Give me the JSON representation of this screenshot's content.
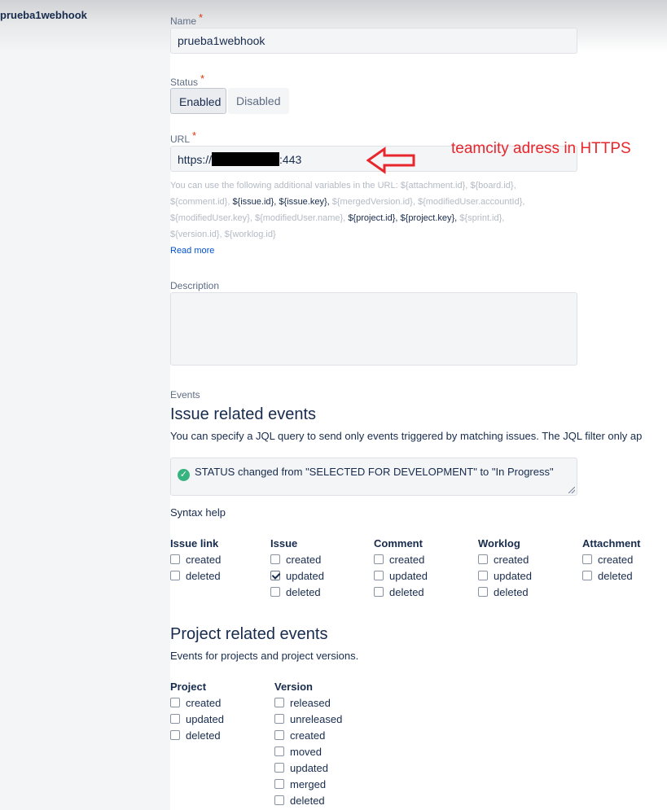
{
  "sidebar": {
    "title": "prueba1webhook"
  },
  "form": {
    "name_label": "Name",
    "required_mark": "*",
    "name_value": "prueba1webhook",
    "status_label": "Status",
    "status_options": [
      "Enabled",
      "Disabled"
    ],
    "status_selected": "Enabled",
    "url_label": "URL",
    "url_prefix": "https://",
    "url_suffix": ":443",
    "help": {
      "intro": "You can use the following additional variables in the URL:",
      "vars": [
        {
          "text": "${attachment.id},",
          "dark": false
        },
        {
          "text": "${board.id},",
          "dark": false
        },
        {
          "text": "${comment.id},",
          "dark": false
        },
        {
          "text": "${issue.id},",
          "dark": true
        },
        {
          "text": "${issue.key},",
          "dark": true
        },
        {
          "text": "${mergedVersion.id},",
          "dark": false
        },
        {
          "text": "${modifiedUser.accountId},",
          "dark": false
        },
        {
          "text": "${modifiedUser.key},",
          "dark": false
        },
        {
          "text": "${modifiedUser.name},",
          "dark": false
        },
        {
          "text": "${project.id},",
          "dark": true
        },
        {
          "text": "${project.key},",
          "dark": true
        },
        {
          "text": "${sprint.id},",
          "dark": false
        },
        {
          "text": "${version.id},",
          "dark": false
        },
        {
          "text": "${worklog.id}",
          "dark": false
        }
      ],
      "read_more": "Read more"
    },
    "description_label": "Description",
    "description_value": ""
  },
  "events": {
    "label": "Events",
    "issue_heading": "Issue related events",
    "issue_desc": "You can specify a JQL query to send only events triggered by matching issues. The JQL filter only ap",
    "jql_value": "STATUS changed from \"SELECTED FOR DEVELOPMENT\" to \"In Progress\"",
    "syntax_help": "Syntax help",
    "issue_groups": [
      {
        "title": "Issue link",
        "items": [
          {
            "label": "created",
            "checked": false
          },
          {
            "label": "deleted",
            "checked": false
          }
        ]
      },
      {
        "title": "Issue",
        "items": [
          {
            "label": "created",
            "checked": false
          },
          {
            "label": "updated",
            "checked": true
          },
          {
            "label": "deleted",
            "checked": false
          }
        ]
      },
      {
        "title": "Comment",
        "items": [
          {
            "label": "created",
            "checked": false
          },
          {
            "label": "updated",
            "checked": false
          },
          {
            "label": "deleted",
            "checked": false
          }
        ]
      },
      {
        "title": "Worklog",
        "items": [
          {
            "label": "created",
            "checked": false
          },
          {
            "label": "updated",
            "checked": false
          },
          {
            "label": "deleted",
            "checked": false
          }
        ]
      },
      {
        "title": "Attachment",
        "items": [
          {
            "label": "created",
            "checked": false
          },
          {
            "label": "deleted",
            "checked": false
          }
        ]
      }
    ],
    "project_heading": "Project related events",
    "project_desc": "Events for projects and project versions.",
    "project_groups": [
      {
        "title": "Project",
        "items": [
          {
            "label": "created",
            "checked": false
          },
          {
            "label": "updated",
            "checked": false
          },
          {
            "label": "deleted",
            "checked": false
          }
        ]
      },
      {
        "title": "Version",
        "items": [
          {
            "label": "released",
            "checked": false
          },
          {
            "label": "unreleased",
            "checked": false
          },
          {
            "label": "created",
            "checked": false
          },
          {
            "label": "moved",
            "checked": false
          },
          {
            "label": "updated",
            "checked": false
          },
          {
            "label": "merged",
            "checked": false
          },
          {
            "label": "deleted",
            "checked": false
          }
        ]
      }
    ]
  },
  "annotation": {
    "text": "teamcity adress in HTTPS",
    "color": "#e8272d"
  },
  "colors": {
    "link": "#0052cc",
    "required": "#de350b",
    "success": "#36b37e"
  }
}
